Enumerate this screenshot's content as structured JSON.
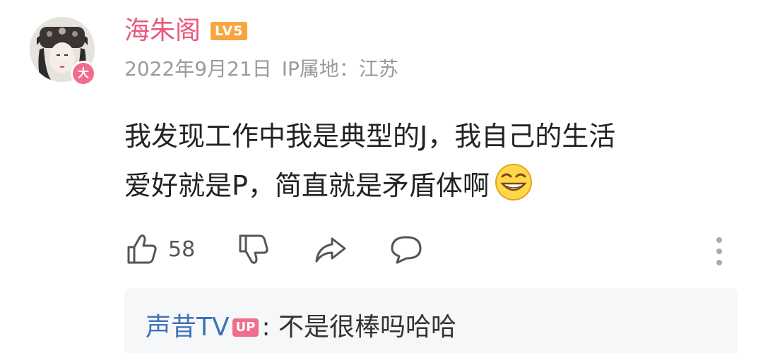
{
  "comment": {
    "author": {
      "name": "海朱阁",
      "level": "LV5",
      "avatar_badge": "大"
    },
    "date": "2022年9月21日",
    "ip_location": "IP属地：江苏",
    "text_line1": "我发现工作中我是典型的J，我自己的生活",
    "text_line2": "爱好就是P，简直就是矛盾体啊",
    "emoji": "grinning-face-emoji",
    "actions": {
      "like_count": "58",
      "icons": [
        "thumbs-up-icon",
        "thumbs-down-icon",
        "share-icon",
        "reply-bubble-icon",
        "more-vertical-icon"
      ]
    },
    "reply": {
      "author": "声昔TV",
      "badge": "UP",
      "separator": ":",
      "text": "不是很棒吗哈哈"
    }
  },
  "colors": {
    "username": "#e9587d",
    "level_badge": "#f6a53f",
    "reply_author": "#3f73b8",
    "up_badge": "#f06d8c"
  }
}
